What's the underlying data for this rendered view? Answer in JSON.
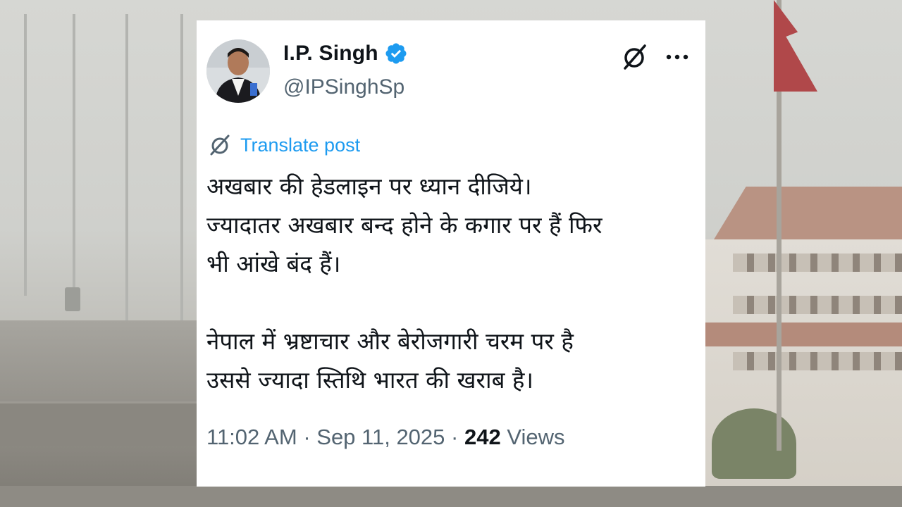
{
  "tweet": {
    "author_name": "I.P. Singh",
    "handle": "@IPSinghSp",
    "translate_label": "Translate post",
    "body_paragraphs": [
      [
        "अखबार की हेडलाइन पर ध्यान दीजिये।",
        "ज्यादातर अखबार बन्द होने के कगार पर हैं फिर",
        "भी आंखे बंद हैं।"
      ],
      [
        "नेपाल में भ्रष्टाचार और बेरोजगारी चरम पर है",
        "उससे ज्यादा स्तिथि भारत की खराब है।"
      ]
    ],
    "time": "11:02 AM",
    "date": "Sep 11, 2025",
    "separator": "·",
    "views_count": "242",
    "views_label": "Views",
    "icons": {
      "verified": "verified-badge-icon",
      "grok": "grok-icon",
      "more": "more-options-icon",
      "translate": "translate-icon"
    }
  },
  "colors": {
    "accent": "#1d9bf0",
    "text_primary": "#0f1419",
    "text_secondary": "#536471",
    "card_background": "#ffffff"
  }
}
